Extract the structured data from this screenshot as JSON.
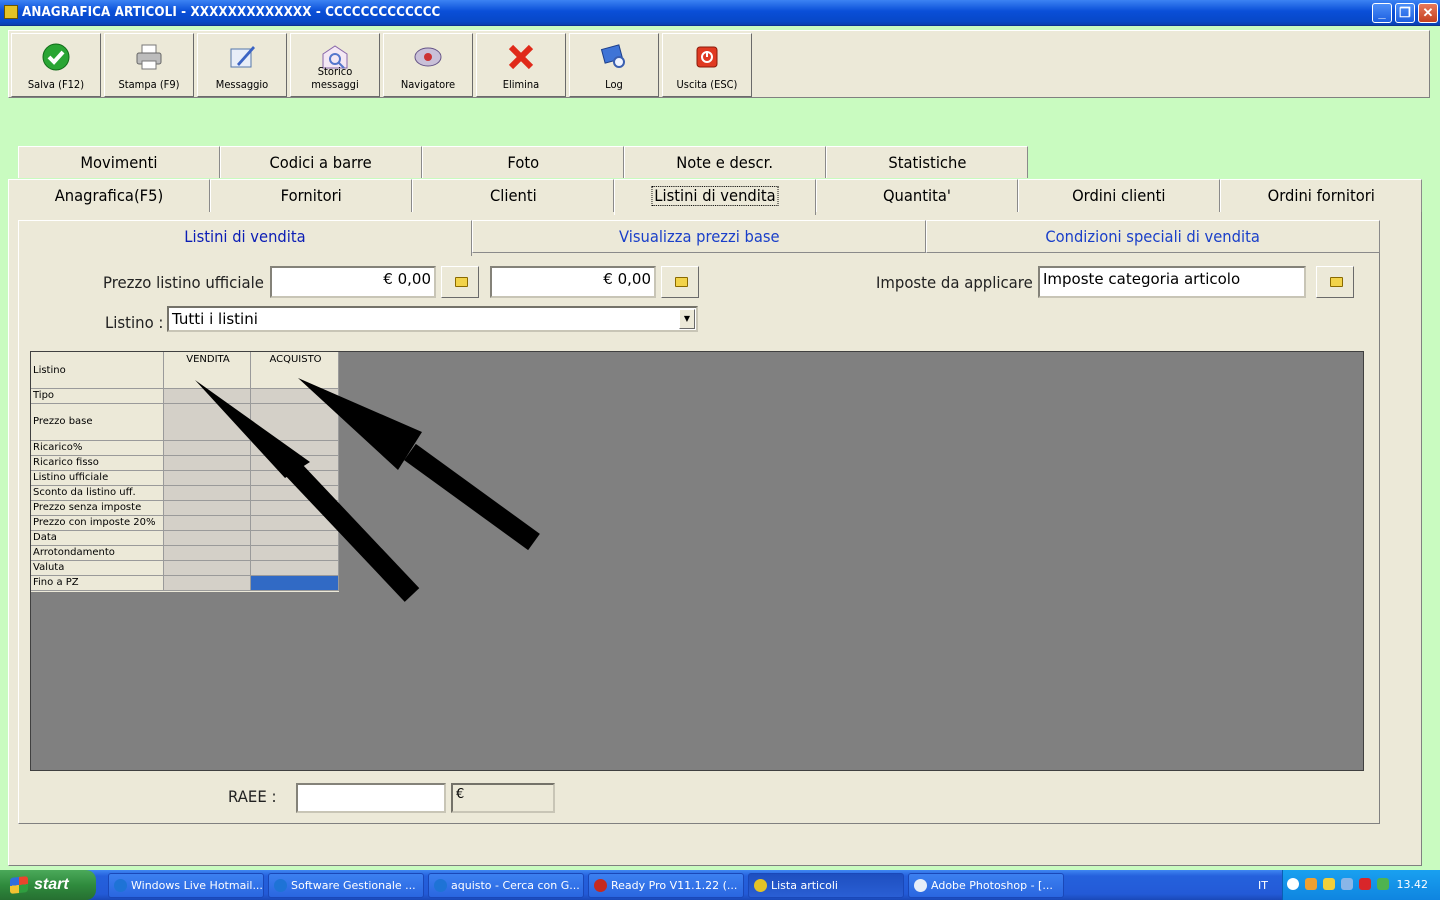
{
  "window": {
    "title": "ANAGRAFICA ARTICOLI - XXXXXXXXXXXXX - CCCCCCCCCCCCC"
  },
  "toolbar": [
    {
      "label": "Salva (F12)",
      "icon": "check-icon"
    },
    {
      "label": "Stampa (F9)",
      "icon": "printer-icon"
    },
    {
      "label": "Messaggio",
      "icon": "message-icon"
    },
    {
      "label": "Storico messaggi",
      "icon": "message-history-icon"
    },
    {
      "label": "Navigatore",
      "icon": "navigator-icon"
    },
    {
      "label": "Elimina",
      "icon": "delete-icon"
    },
    {
      "label": "Log",
      "icon": "log-icon"
    },
    {
      "label": "Uscita (ESC)",
      "icon": "exit-icon"
    }
  ],
  "tabs_row1": [
    "Movimenti",
    "Codici a barre",
    "Foto",
    "Note e descr.",
    "Statistiche"
  ],
  "tabs_row2": [
    "Anagrafica(F5)",
    "Fornitori",
    "Clienti",
    "Listini di vendita",
    "Quantita'",
    "Ordini clienti",
    "Ordini fornitori"
  ],
  "active_tab": "Listini di vendita",
  "subtabs": [
    "Listini di vendita",
    "Visualizza prezzi base",
    "Condizioni speciali di vendita"
  ],
  "form": {
    "prezzo_label": "Prezzo listino ufficiale :",
    "prezzo_value1": "€ 0,00",
    "prezzo_value2": "€ 0,00",
    "imposte_label": "Imposte da applicare :",
    "imposte_value": "Imposte categoria articolo",
    "listino_label": "Listino :",
    "listino_value": "Tutti i listini",
    "raee_label": "RAEE :",
    "raee_value": "",
    "raee_currency": "€"
  },
  "grid": {
    "corner": "Listino",
    "columns": [
      "VENDITA",
      "ACQUISTO"
    ],
    "rows": [
      "Tipo",
      "Prezzo base",
      "Ricarico%",
      "Ricarico fisso",
      "Listino ufficiale",
      "Sconto da listino uff.",
      "Prezzo senza imposte",
      "Prezzo con imposte 20%",
      "Data",
      "Arrotondamento",
      "Valuta",
      "Fino a PZ"
    ]
  },
  "taskbar": {
    "start_label": "start",
    "tasks": [
      {
        "label": "Windows Live Hotmail..."
      },
      {
        "label": "Software Gestionale ..."
      },
      {
        "label": "aquisto - Cerca con G..."
      },
      {
        "label": "Ready Pro V11.1.22 (..."
      },
      {
        "label": "Lista articoli"
      },
      {
        "label": "Adobe Photoshop - [..."
      }
    ],
    "language": "IT",
    "clock": "13.42"
  }
}
